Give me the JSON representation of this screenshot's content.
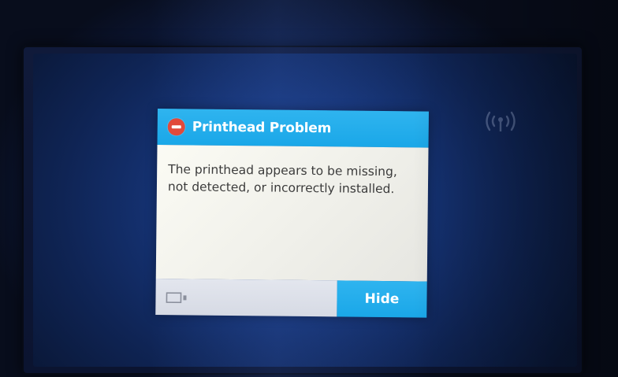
{
  "dialog": {
    "title": "Printhead Problem",
    "title_icon": "stop-icon",
    "message_line1": "The printhead appears to be missing,",
    "message_line2": "not detected, or incorrectly installed.",
    "header_color": "#1aa7e8",
    "icon_color": "#e14a3b"
  },
  "footer": {
    "left_icon": "screen-icon",
    "hide_label": "Hide"
  },
  "status": {
    "wireless_icon": "wireless-icon"
  }
}
